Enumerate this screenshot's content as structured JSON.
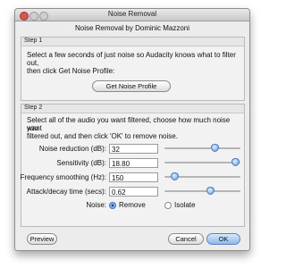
{
  "window": {
    "title": "Noise Removal"
  },
  "header": {
    "subtitle": "Noise Removal by Dominic Mazzoni"
  },
  "step1": {
    "label": "Step 1",
    "line1": "Select a few seconds of just noise so Audacity knows what to filter",
    "line2": "out,",
    "line3": "then click Get Noise Profile:",
    "button": "Get Noise Profile"
  },
  "step2": {
    "label": "Step 2",
    "line1": "Select all of the audio you want filtered, choose how much noise you",
    "line2": "want",
    "line3": "filtered out, and then click 'OK' to remove noise.",
    "rows": [
      {
        "label": "Noise reduction (dB):",
        "value": "32",
        "slider": 0.66
      },
      {
        "label": "Sensitivity (dB):",
        "value": "18.80",
        "slider": 0.93
      },
      {
        "label": "Frequency smoothing (Hz):",
        "value": "150",
        "slider": 0.13
      },
      {
        "label": "Attack/decay time (secs):",
        "value": "0.62",
        "slider": 0.6
      }
    ],
    "noise_label": "Noise:",
    "noise_options": [
      "Remove",
      "Isolate"
    ],
    "noise_selected": "Remove"
  },
  "buttons": {
    "preview": "Preview",
    "cancel": "Cancel",
    "ok": "OK"
  }
}
